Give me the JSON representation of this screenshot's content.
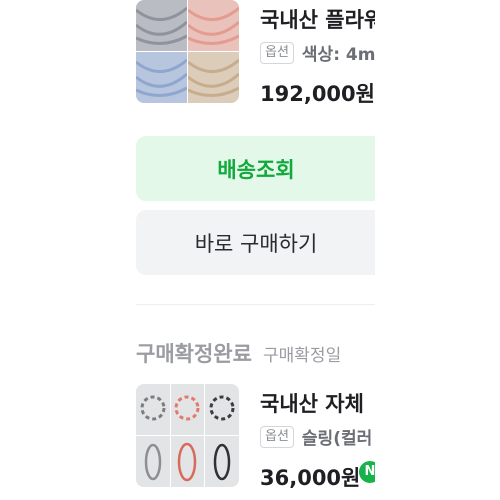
{
  "order_item_1": {
    "title": "국내산 플라워",
    "option_badge": "옵션",
    "option_text": "색상: 4m",
    "price": "192,000원"
  },
  "buttons": {
    "shipping_label": "배송조회",
    "buy_again_label": "바로 구매하기"
  },
  "section_2": {
    "status": "구매확정완료",
    "status_date_label": "구매확정일"
  },
  "order_item_2": {
    "title": "국내산 자체",
    "option_badge": "옵션",
    "option_text": "슬링(컬러",
    "price": "36,000원",
    "badge_icon": "naver-pay-icon",
    "badge_letter": "N"
  },
  "colors": {
    "shipping_bg": "#e4f8e9",
    "shipping_text": "#11a83c",
    "buy_bg": "#f2f3f5",
    "status_text": "#9a9ca2",
    "naver_green": "#17b34a"
  }
}
